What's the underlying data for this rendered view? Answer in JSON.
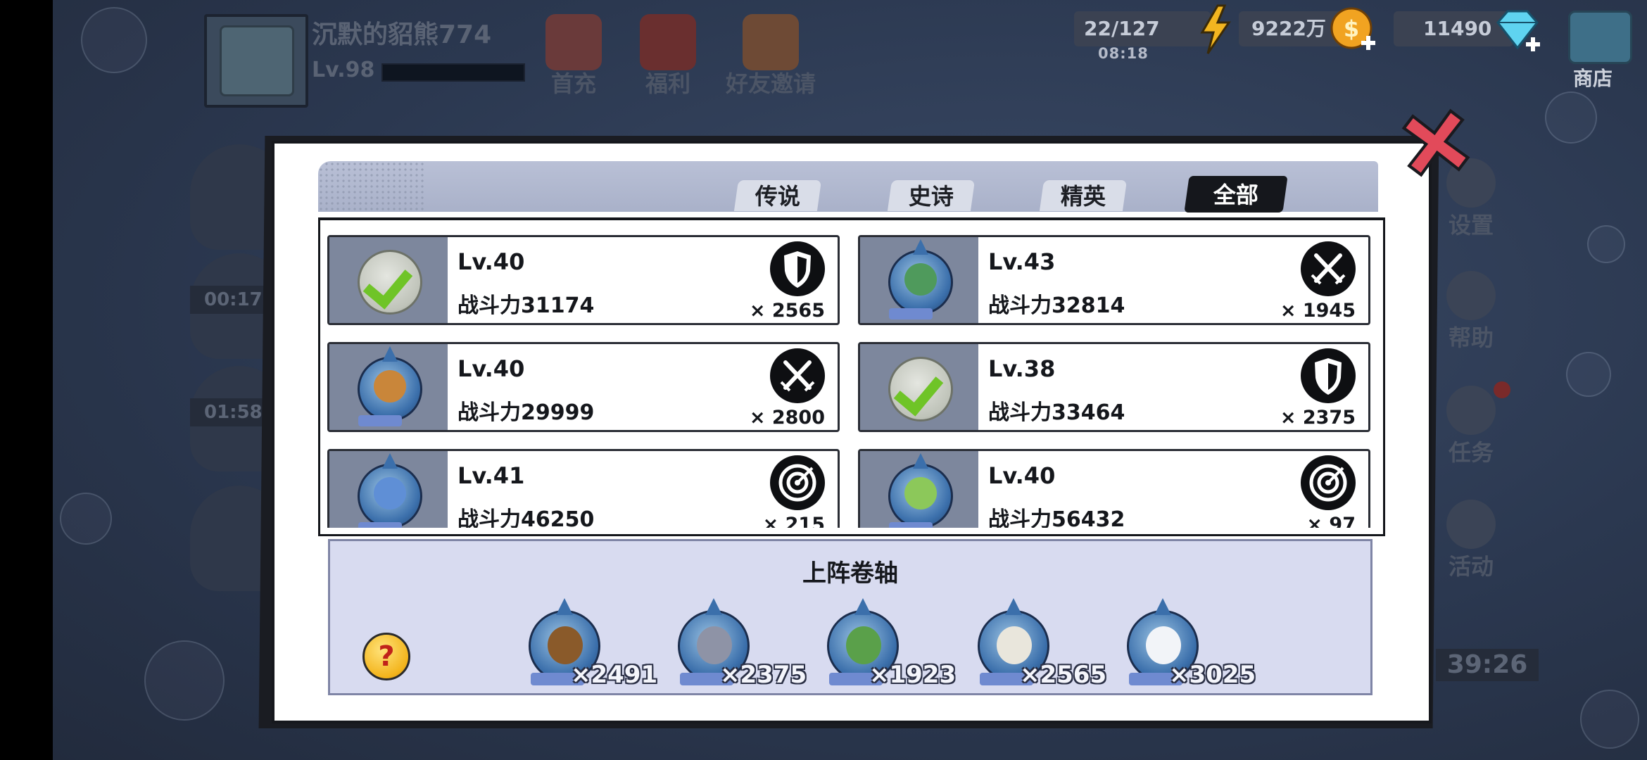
{
  "player": {
    "name": "沉默的貂熊774",
    "level": "Lv.98"
  },
  "top_buttons": [
    {
      "label": "首充",
      "color": "#6a3a3a"
    },
    {
      "label": "福利",
      "color": "#6a2f2f"
    },
    {
      "label": "好友邀请",
      "color": "#6e4a35"
    }
  ],
  "resources": {
    "energy": "22/127",
    "energy_timer": "08:18",
    "gold": "9222万",
    "diamond": "11490"
  },
  "shop_label": "商店",
  "side_buttons": [
    {
      "label": "设置"
    },
    {
      "label": "帮助"
    },
    {
      "label": "任务"
    },
    {
      "label": "活动"
    }
  ],
  "background_timers": {
    "slot1": "00:17:",
    "slot2": "01:58:",
    "bottom_right": "39:26"
  },
  "modal": {
    "tabs": [
      "传说",
      "史诗",
      "精英",
      "全部"
    ],
    "active_tab": "全部",
    "heroes": [
      {
        "level": "Lv.40",
        "power": "战斗力31174",
        "type": "shield",
        "count": "× 2565",
        "selected": true
      },
      {
        "level": "Lv.43",
        "power": "战斗力32814",
        "type": "swords",
        "count": "× 1945",
        "selected": false
      },
      {
        "level": "Lv.40",
        "power": "战斗力29999",
        "type": "swords",
        "count": "× 2800",
        "selected": false
      },
      {
        "level": "Lv.38",
        "power": "战斗力33464",
        "type": "shield",
        "count": "× 2375",
        "selected": true
      },
      {
        "level": "Lv.41",
        "power": "战斗力46250",
        "type": "target",
        "count": "× 215",
        "selected": false
      },
      {
        "level": "Lv.40",
        "power": "战斗力56432",
        "type": "target",
        "count": "× 97",
        "selected": false
      }
    ],
    "scroll_panel": {
      "title": "上阵卷轴",
      "help_symbol": "?",
      "items": [
        {
          "count": "×2491",
          "color": "#8a5a2a"
        },
        {
          "count": "×2375",
          "color": "#8e93a6"
        },
        {
          "count": "×1923",
          "color": "#5aa04a"
        },
        {
          "count": "×2565",
          "color": "#e9e6dc"
        },
        {
          "count": "×3025",
          "color": "#f2f4f8"
        }
      ]
    }
  }
}
